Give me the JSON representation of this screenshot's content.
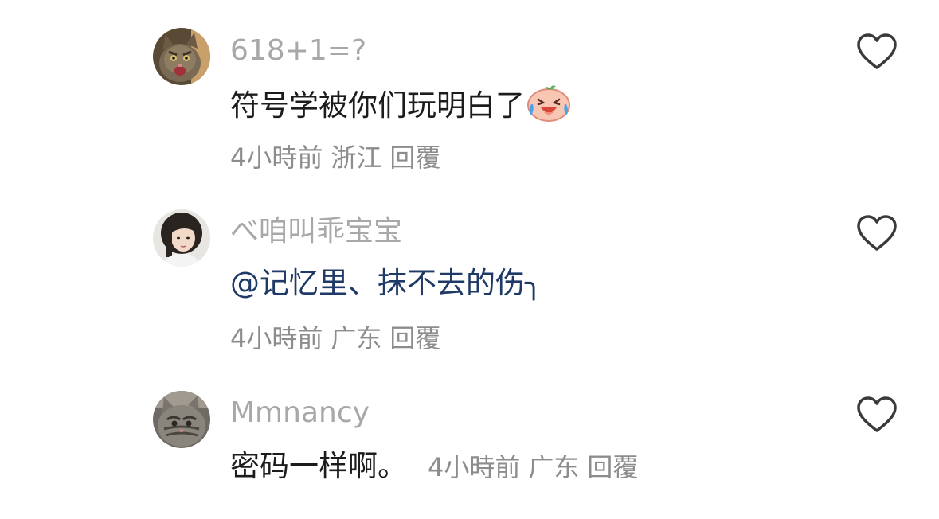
{
  "colors": {
    "background": "#ffffff",
    "username": "#a8a8a8",
    "content": "#1c1c1c",
    "mention": "#1f3a66",
    "meta": "#8c8c8c",
    "heart_outline": "#3a3a3a"
  },
  "comments": [
    {
      "username": "618+1=?",
      "content": "符号学被你们玩明白了",
      "emoji": "crying-laughing-face",
      "time": "4小時前",
      "location": "浙江",
      "reply_label": "回覆",
      "like_icon": "heart-outline-icon",
      "avatar": "cat-avatar"
    },
    {
      "username": "べ咱叫乖宝宝",
      "content": "@记忆里、抹不去的伤╮",
      "time": "4小時前",
      "location": "广东",
      "reply_label": "回覆",
      "like_icon": "heart-outline-icon",
      "avatar": "girl-avatar"
    },
    {
      "username": "Mmnancy",
      "content": "密码一样啊。",
      "time": "4小時前",
      "location": "广东",
      "reply_label": "回覆",
      "like_icon": "heart-outline-icon",
      "avatar": "tabby-cat-avatar"
    }
  ]
}
